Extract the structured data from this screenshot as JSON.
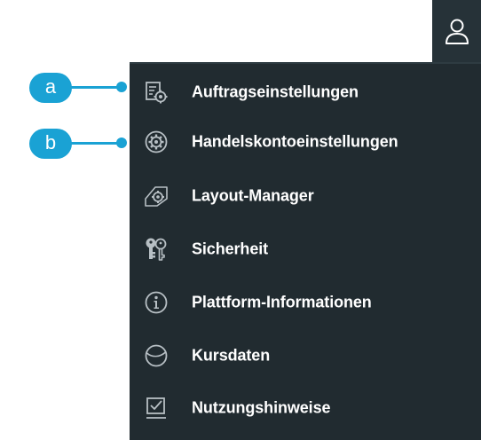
{
  "header": {
    "user_icon": "user-icon"
  },
  "menu": {
    "items": [
      {
        "label": "Auftragseinstellungen",
        "icon": "order-settings-icon"
      },
      {
        "label": "Handelskontoeinstellungen",
        "icon": "gear-icon"
      },
      {
        "label": "Layout-Manager",
        "icon": "layout-manager-icon"
      },
      {
        "label": "Sicherheit",
        "icon": "keys-icon"
      },
      {
        "label": "Plattform-Informationen",
        "icon": "info-icon"
      },
      {
        "label": "Kursdaten",
        "icon": "globe-icon"
      },
      {
        "label": "Nutzungshinweise",
        "icon": "checkbox-icon"
      }
    ]
  },
  "callouts": {
    "a": "a",
    "b": "b"
  },
  "colors": {
    "menu_background": "#212b30",
    "header_background": "#263238",
    "callout": "#1aa2d4",
    "icon": "#b7bfc4",
    "text": "#ffffff"
  }
}
